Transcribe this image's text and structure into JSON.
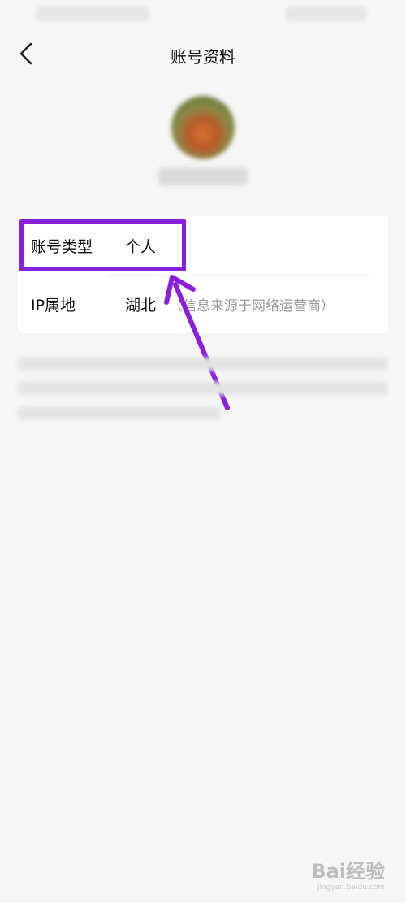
{
  "header": {
    "title": "账号资料"
  },
  "account_info": {
    "rows": [
      {
        "label": "账号类型",
        "value": "个人"
      },
      {
        "label": "IP属地",
        "value": "湖北",
        "note": "（信息来源于网络运营商）"
      }
    ]
  },
  "annotation": {
    "highlight_color": "#8a1fdc"
  },
  "watermark": {
    "logo": "Bai经验",
    "url": "jingyan.baidu.com"
  }
}
